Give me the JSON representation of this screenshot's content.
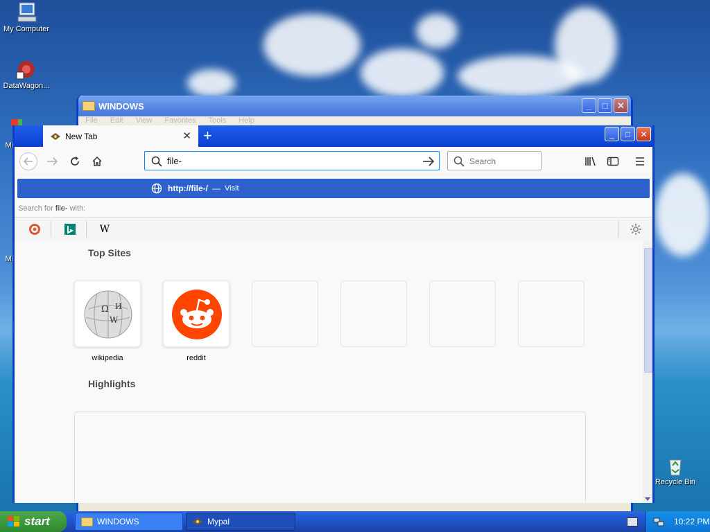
{
  "desktop": {
    "icons": [
      {
        "label": "My Computer"
      },
      {
        "label": "DataWagon..."
      },
      {
        "label": "Mic"
      },
      {
        "label": "Mic"
      },
      {
        "label": "Recycle Bin"
      }
    ]
  },
  "back_window": {
    "title": "WINDOWS",
    "menu": [
      "File",
      "Edit",
      "View",
      "Favorites",
      "Tools",
      "Help"
    ]
  },
  "browser": {
    "tab": {
      "title": "New Tab"
    },
    "urlbar": {
      "value": "file-"
    },
    "searchbar": {
      "placeholder": "Search"
    },
    "suggestion": {
      "url": "http://file-/",
      "separator": "—",
      "action": "Visit"
    },
    "search_with": {
      "prefix": "Search for",
      "term": "file-",
      "suffix": "with:"
    },
    "engines": [
      {
        "name": "duckduckgo-icon"
      },
      {
        "name": "bing-icon"
      },
      {
        "name": "wikipedia-icon",
        "glyph": "W"
      }
    ],
    "top_sites": {
      "heading": "Top Sites",
      "sites": [
        {
          "label": "wikipedia"
        },
        {
          "label": "reddit"
        }
      ]
    },
    "highlights": {
      "heading": "Highlights"
    }
  },
  "taskbar": {
    "start_label": "start",
    "tasks": [
      {
        "label": "WINDOWS"
      },
      {
        "label": "Mypal"
      }
    ],
    "clock": "10:22 PM"
  },
  "colors": {
    "accent": "#0a84ff",
    "suggestion_bg": "#2d62ce",
    "reddit": "#ff4500"
  }
}
